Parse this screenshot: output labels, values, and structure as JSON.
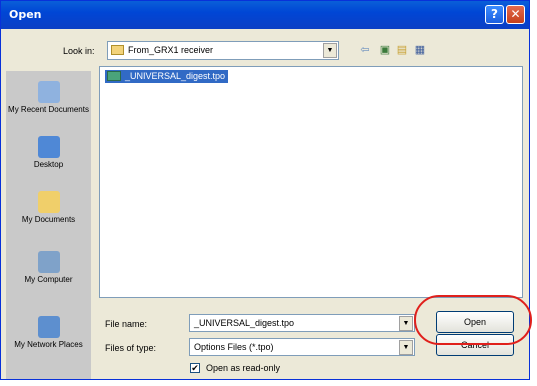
{
  "window": {
    "title": "Open",
    "help_label": "?",
    "close_label": "✕"
  },
  "toolbar": {
    "lookin_label": "Look in:",
    "lookin_value": "From_GRX1 receiver",
    "dropdown_glyph": "▼",
    "icons": [
      "back-arrow-icon",
      "up-folder-icon",
      "new-folder-icon",
      "views-menu-icon"
    ]
  },
  "places": [
    {
      "label": "My Recent Documents",
      "icon": "recent-documents-icon"
    },
    {
      "label": "Desktop",
      "icon": "desktop-icon"
    },
    {
      "label": "My Documents",
      "icon": "my-documents-icon"
    },
    {
      "label": "My Computer",
      "icon": "my-computer-icon"
    },
    {
      "label": "My Network Places",
      "icon": "network-places-icon"
    }
  ],
  "files": [
    {
      "name": "_UNIVERSAL_digest.tpo",
      "selected": true
    }
  ],
  "form": {
    "filename_label": "File name:",
    "filename_value": "_UNIVERSAL_digest.tpo",
    "filetype_label": "Files of type:",
    "filetype_value": "Options Files (*.tpo)",
    "readonly_label": "Open as read-only",
    "readonly_checked": true
  },
  "buttons": {
    "open": "Open",
    "cancel": "Cancel"
  },
  "colors": {
    "title_bar": "#0046d5",
    "selection": "#316ac5",
    "annotation_ring": "#e0201c"
  }
}
